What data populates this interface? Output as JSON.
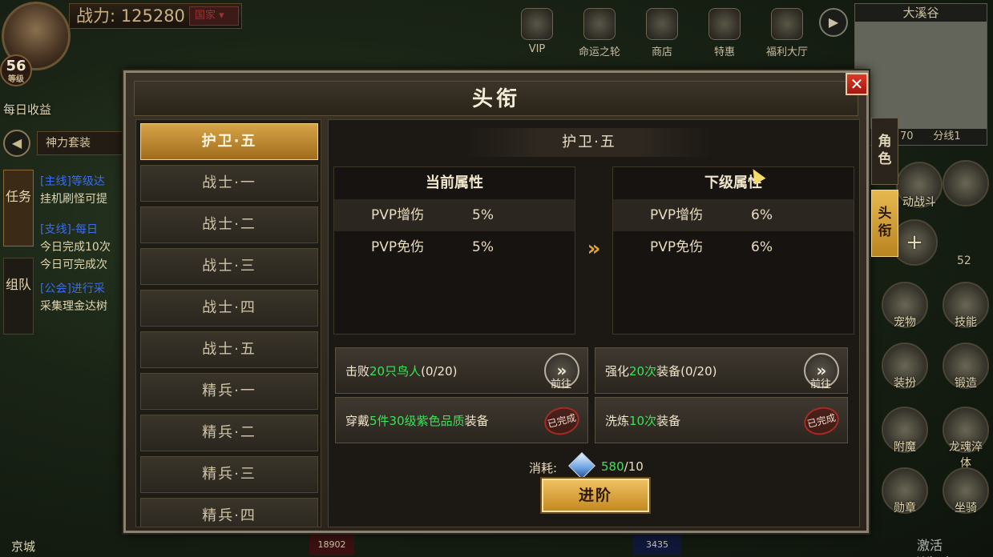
{
  "hud": {
    "power_label": "战力: 125280",
    "country_btn": "国家",
    "level": "56",
    "level_unit": "等级",
    "daily_income": "每日收益",
    "suit_btn": "神力套装",
    "tab_quest": "任务",
    "tab_team": "组队",
    "quests": [
      {
        "tag": "[主线]等级达",
        "text": "挂机刷怪可提"
      },
      {
        "tag": "[支线]-每日",
        "text": "今日完成10次"
      },
      {
        "tag": "",
        "text": "今日可完成次"
      },
      {
        "tag": "[公会]进行采",
        "text": "采集理金达树"
      }
    ],
    "top_icons": [
      "VIP",
      "命运之轮",
      "商店",
      "特惠",
      "福利大厅"
    ],
    "map_name": "大溪谷",
    "map_coord": "70",
    "map_line": "分线1",
    "right_buttons": [
      "动战斗",
      "宠物",
      "技能",
      "装扮",
      "锻造",
      "附魔",
      "龙魂淬体",
      "勋章",
      "坐骑"
    ],
    "bag_count": "52",
    "bottom_left": "京城",
    "bottom_val_1": "18902",
    "bottom_val_2": "3435",
    "watermark": "激活 Window"
  },
  "dialog": {
    "title": "头衔",
    "close": "✕",
    "side_tabs": [
      "角色",
      "头衔"
    ],
    "ranks": [
      "护卫·五",
      "战士·一",
      "战士·二",
      "战士·三",
      "战士·四",
      "战士·五",
      "精兵·一",
      "精兵·二",
      "精兵·三",
      "精兵·四"
    ],
    "active_rank": "护卫·五",
    "current_header": "当前属性",
    "next_header": "下级属性",
    "current_attrs": [
      {
        "name": "PVP增伤",
        "value": "5%"
      },
      {
        "name": "PVP免伤",
        "value": "5%"
      }
    ],
    "next_attrs": [
      {
        "name": "PVP增伤",
        "value": "6%"
      },
      {
        "name": "PVP免伤",
        "value": "6%"
      }
    ],
    "arrow": "»",
    "tasks": [
      {
        "pre": "击败",
        "hl": "20只鸟人",
        "post": "(0/20)",
        "status": "go"
      },
      {
        "pre": "强化",
        "hl": "20次",
        "post": "装备(0/20)",
        "status": "go"
      },
      {
        "pre": "穿戴",
        "hl": "5件30级紫色品质",
        "post": "装备",
        "status": "done"
      },
      {
        "pre": "洗炼",
        "hl": "10次",
        "post": "装备",
        "status": "done"
      }
    ],
    "go_label": "前往",
    "go_icon": "»",
    "done_label": "已完成",
    "cost_label": "消耗:",
    "cost_have": "580",
    "cost_need": "/10",
    "advance_btn": "进阶"
  },
  "colors": {
    "accent_gold": "#d8a448",
    "highlight_green": "#3ee05a",
    "close_red": "#e03828"
  }
}
